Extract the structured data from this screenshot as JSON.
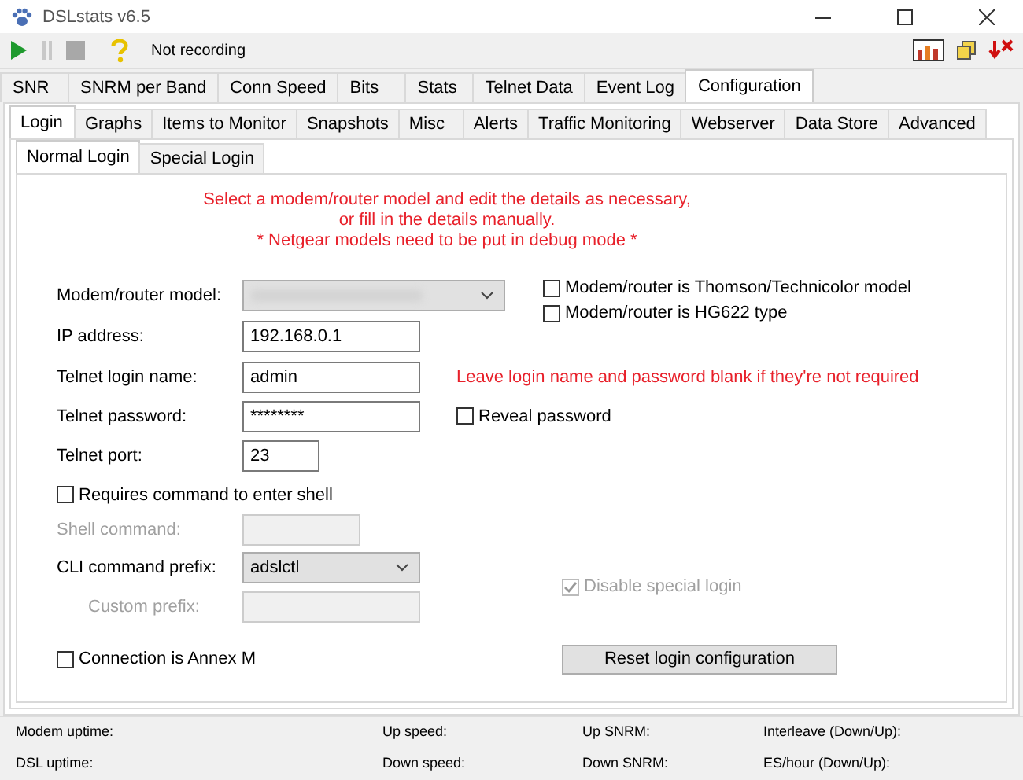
{
  "window": {
    "title": "DSLstats v6.5"
  },
  "toolbar": {
    "status": "Not recording"
  },
  "main_tabs": [
    {
      "label": "SNR",
      "selected": false
    },
    {
      "label": "SNRM per Band",
      "selected": false
    },
    {
      "label": "Conn Speed",
      "selected": false
    },
    {
      "label": "Bits",
      "selected": false
    },
    {
      "label": "Stats",
      "selected": false
    },
    {
      "label": "Telnet Data",
      "selected": false
    },
    {
      "label": "Event Log",
      "selected": false
    },
    {
      "label": "Configuration",
      "selected": true
    }
  ],
  "config_tabs": [
    {
      "label": "Login",
      "selected": true
    },
    {
      "label": "Graphs",
      "selected": false
    },
    {
      "label": "Items to Monitor",
      "selected": false
    },
    {
      "label": "Snapshots",
      "selected": false
    },
    {
      "label": "Misc",
      "selected": false
    },
    {
      "label": "Alerts",
      "selected": false
    },
    {
      "label": "Traffic Monitoring",
      "selected": false
    },
    {
      "label": "Webserver",
      "selected": false
    },
    {
      "label": "Data Store",
      "selected": false
    },
    {
      "label": "Advanced",
      "selected": false
    }
  ],
  "login_tabs": [
    {
      "label": "Normal Login",
      "selected": true
    },
    {
      "label": "Special Login",
      "selected": false
    }
  ],
  "intro": [
    "Select a modem/router model and edit the details as necessary,",
    "or fill in the details manually.",
    "* Netgear models need to be put in debug mode *"
  ],
  "model": {
    "label": "Modem/router model:"
  },
  "thomson": {
    "label": "Modem/router is Thomson/Technicolor model",
    "checked": false
  },
  "hg622": {
    "label": "Modem/router is HG622 type",
    "checked": false
  },
  "ip": {
    "label": "IP address:",
    "value": "192.168.0.1"
  },
  "login_name": {
    "label": "Telnet login name:",
    "value": "admin"
  },
  "login_hint": "Leave login name and password blank if they're not required",
  "password": {
    "label": "Telnet password:",
    "value": "********"
  },
  "reveal": {
    "label": "Reveal password",
    "checked": false
  },
  "port": {
    "label": "Telnet port:",
    "value": "23"
  },
  "requires_shell": {
    "label": "Requires command to enter shell",
    "checked": false
  },
  "shell_command": {
    "label": "Shell command:",
    "disabled": true
  },
  "cli_prefix": {
    "label": "CLI command prefix:",
    "value": "adslctl"
  },
  "custom_prefix": {
    "label": "Custom prefix:",
    "disabled": true
  },
  "disable_special": {
    "label": "Disable special login",
    "checked": true,
    "disabled": true
  },
  "annex_m": {
    "label": "Connection is Annex M",
    "checked": false
  },
  "reset_button": "Reset login configuration",
  "status_bar": [
    "Modem uptime:",
    "Up speed:",
    "Up SNRM:",
    "Interleave (Down/Up):",
    "DSL uptime:",
    "Down speed:",
    "Down SNRM:",
    "ES/hour (Down/Up):"
  ]
}
